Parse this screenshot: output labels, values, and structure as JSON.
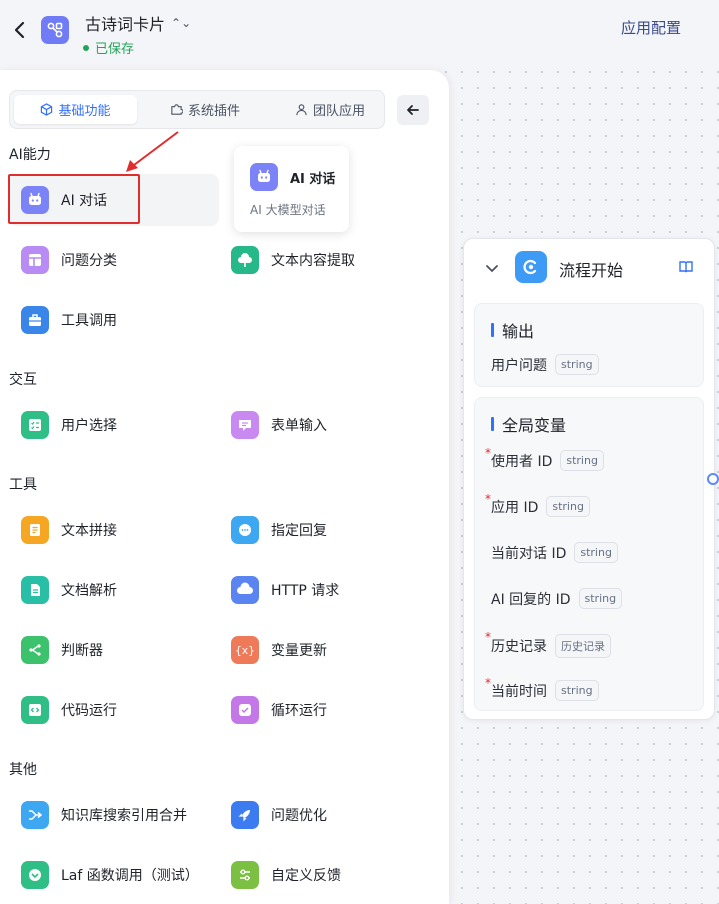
{
  "header": {
    "title": "古诗词卡片",
    "title_caret": "⌃",
    "saved_text": "已保存",
    "config_label": "应用配置"
  },
  "tabs": [
    {
      "label": "基础功能",
      "icon": "cube-icon",
      "active": true
    },
    {
      "label": "系统插件",
      "icon": "puzzle-icon",
      "active": false
    },
    {
      "label": "团队应用",
      "icon": "user-icon",
      "active": false
    }
  ],
  "sections": {
    "ai": "AI能力",
    "interact": "交互",
    "tools": "工具",
    "other": "其他"
  },
  "items": {
    "ai_chat": "AI 对话",
    "classify": "问题分类",
    "extract": "文本内容提取",
    "tool_call": "工具调用",
    "user_select": "用户选择",
    "form_input": "表单输入",
    "text_concat": "文本拼接",
    "reply": "指定回复",
    "doc_parse": "文档解析",
    "http": "HTTP 请求",
    "judge": "判断器",
    "var_update": "变量更新",
    "code_run": "代码运行",
    "loop_run": "循环运行",
    "kb_merge": "知识库搜索引用合并",
    "optimize": "问题优化",
    "laf": "Laf 函数调用（测试）",
    "feedback": "自定义反馈"
  },
  "tooltip": {
    "title": "AI 对话",
    "desc": "AI 大模型对话"
  },
  "node": {
    "title": "流程开始",
    "output": {
      "title": "输出",
      "vars": [
        {
          "name": "用户问题",
          "type": "string"
        }
      ]
    },
    "globals": {
      "title": "全局变量",
      "required_mark": "*",
      "vars": [
        {
          "name": "使用者 ID",
          "type": "string",
          "required": true
        },
        {
          "name": "应用 ID",
          "type": "string",
          "required": true
        },
        {
          "name": "当前对话 ID",
          "type": "string",
          "required": false
        },
        {
          "name": "AI 回复的 ID",
          "type": "string",
          "required": false
        },
        {
          "name": "历史记录",
          "type": "历史记录",
          "required": true
        },
        {
          "name": "当前时间",
          "type": "string",
          "required": true
        }
      ]
    }
  },
  "colors": {
    "accent": "#3370ff",
    "saved": "#26a35a",
    "highlight": "#e02d2d"
  }
}
